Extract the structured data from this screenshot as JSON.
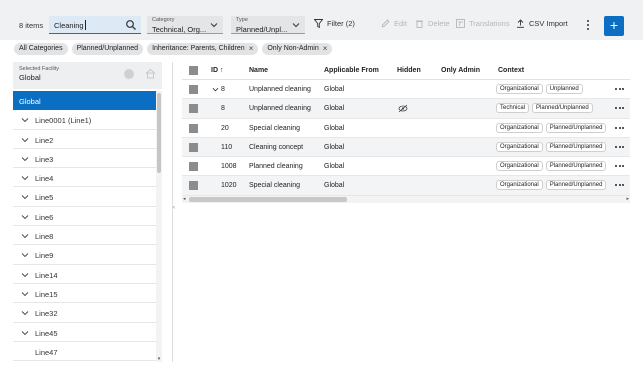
{
  "toolbar": {
    "items_count": "8 items",
    "search": {
      "value": "Cleaning"
    },
    "category": {
      "label": "Category",
      "value": "Technical, Org..."
    },
    "type": {
      "label": "Type",
      "value": "Planned/Unpl..."
    },
    "filter_label": "Filter (2)",
    "edit_label": "Edit",
    "delete_label": "Delete",
    "translations_label": "Translations",
    "csv_import_label": "CSV Import",
    "add_label": "+"
  },
  "chips": [
    {
      "label": "All Categories",
      "removable": false
    },
    {
      "label": "Planned/Unplanned",
      "removable": false
    },
    {
      "label": "Inheritance: Parents, Children",
      "removable": true
    },
    {
      "label": "Only Non-Admin",
      "removable": true
    }
  ],
  "facility": {
    "label": "Selected Facility",
    "value": "Global"
  },
  "tree": [
    {
      "label": "Global",
      "selected": true,
      "expandable": false
    },
    {
      "label": "Line0001 (Line1)",
      "selected": false,
      "expandable": true
    },
    {
      "label": "Line2",
      "selected": false,
      "expandable": true
    },
    {
      "label": "Line3",
      "selected": false,
      "expandable": true
    },
    {
      "label": "Line4",
      "selected": false,
      "expandable": true
    },
    {
      "label": "Line5",
      "selected": false,
      "expandable": true
    },
    {
      "label": "Line6",
      "selected": false,
      "expandable": true
    },
    {
      "label": "Line8",
      "selected": false,
      "expandable": true
    },
    {
      "label": "Line9",
      "selected": false,
      "expandable": true
    },
    {
      "label": "Line14",
      "selected": false,
      "expandable": true
    },
    {
      "label": "Line15",
      "selected": false,
      "expandable": true
    },
    {
      "label": "Line32",
      "selected": false,
      "expandable": true
    },
    {
      "label": "Line45",
      "selected": false,
      "expandable": true
    },
    {
      "label": "Line47",
      "selected": false,
      "expandable": false
    }
  ],
  "table": {
    "headers": {
      "id": "ID",
      "sort_arrow": "↑",
      "name": "Name",
      "applicable_from": "Applicable From",
      "hidden": "Hidden",
      "only_admin": "Only Admin",
      "context": "Context"
    },
    "rows": [
      {
        "id": "8",
        "name": "Unplanned cleaning",
        "applicable_from": "Global",
        "hidden": false,
        "context": [
          "Organizational",
          "Unplanned"
        ],
        "expandable": true
      },
      {
        "id": "8",
        "name": "Unplanned cleaning",
        "applicable_from": "Global",
        "hidden": true,
        "context": [
          "Technical",
          "Planned/Unplanned"
        ],
        "expandable": false
      },
      {
        "id": "20",
        "name": "Special cleaning",
        "applicable_from": "Global",
        "hidden": false,
        "context": [
          "Organizational",
          "Planned/Unplanned"
        ],
        "expandable": false
      },
      {
        "id": "110",
        "name": "Cleaning concept",
        "applicable_from": "Global",
        "hidden": false,
        "context": [
          "Organizational",
          "Planned/Unplanned"
        ],
        "expandable": false
      },
      {
        "id": "1008",
        "name": "Planned cleaning",
        "applicable_from": "Global",
        "hidden": false,
        "context": [
          "Organizational",
          "Planned/Unplanned"
        ],
        "expandable": false
      },
      {
        "id": "1020",
        "name": "Special cleaning",
        "applicable_from": "Global",
        "hidden": false,
        "context": [
          "Organizational",
          "Planned/Unplanned"
        ],
        "expandable": false
      }
    ]
  },
  "colors": {
    "accent": "#0a6fc2",
    "toolbar_bg": "#f0f1f2",
    "checkbox": "#8b8c8d"
  }
}
